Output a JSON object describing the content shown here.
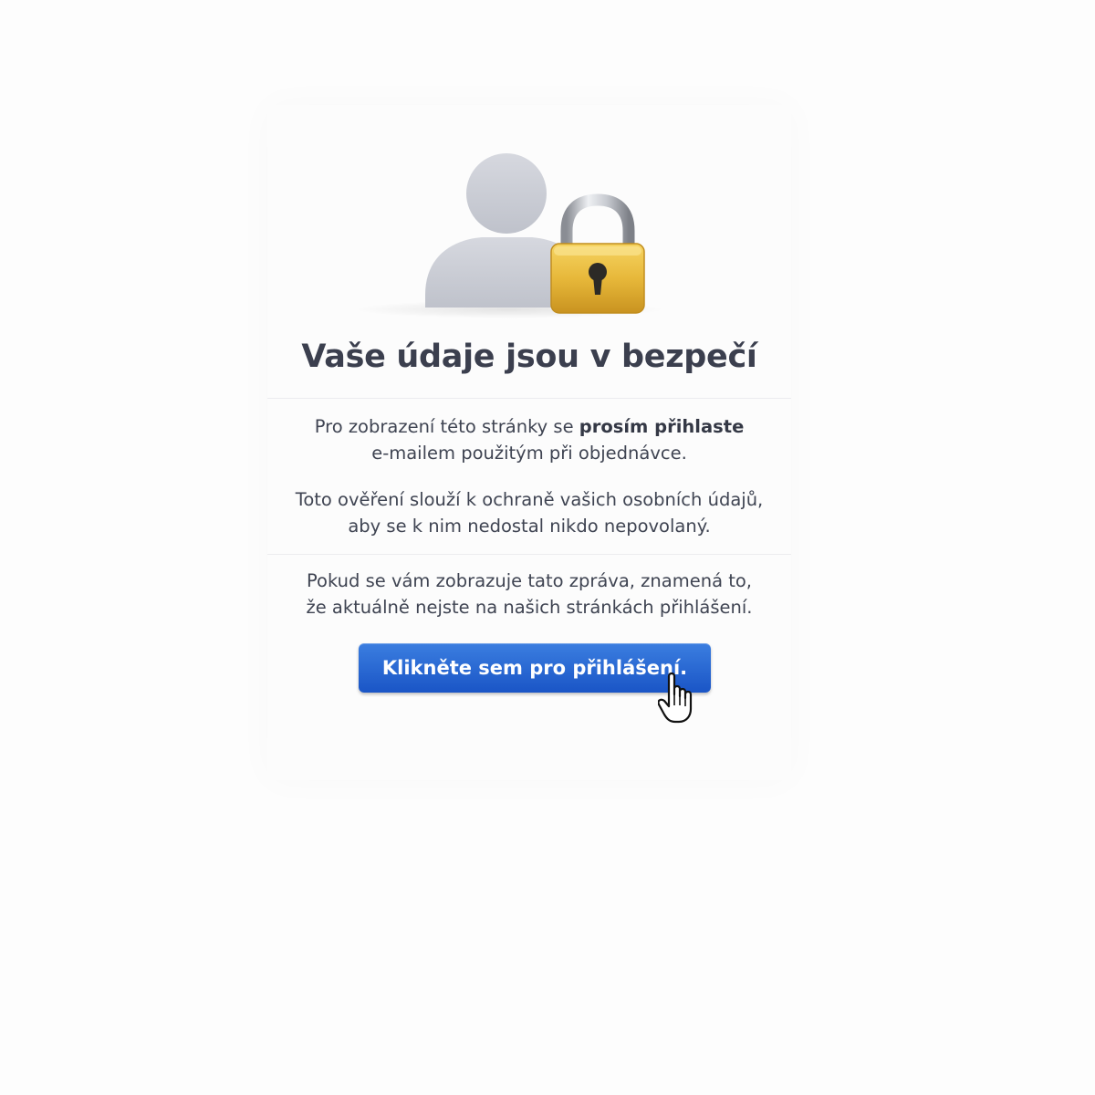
{
  "title": "Vaše údaje jsou v bezpečí",
  "paragraphs": {
    "p1_before": "Pro zobrazení této stránky se ",
    "p1_bold": "prosím přihlaste",
    "p1_line2": "e-mailem použitým při objednávce.",
    "p2_line1": "Toto ověření slouží k ochraně vašich osobních údajů,",
    "p2_line2": "aby se k nim nedostal nikdo nepovolaný.",
    "p3_line1": "Pokud se vám zobrazuje tato zpráva, znamená to,",
    "p3_line2": "že aktuálně nejste na našich stránkách přihlášení."
  },
  "login_button": {
    "label": "Klikněte sem pro přihlášení."
  },
  "icons": {
    "user": "user-silhouette-icon",
    "lock": "padlock-icon",
    "cursor": "hand-pointer-cursor-icon"
  },
  "colors": {
    "button": "#1f5fd0",
    "lock": "#e8b93a",
    "user": "#c8cbd4"
  }
}
